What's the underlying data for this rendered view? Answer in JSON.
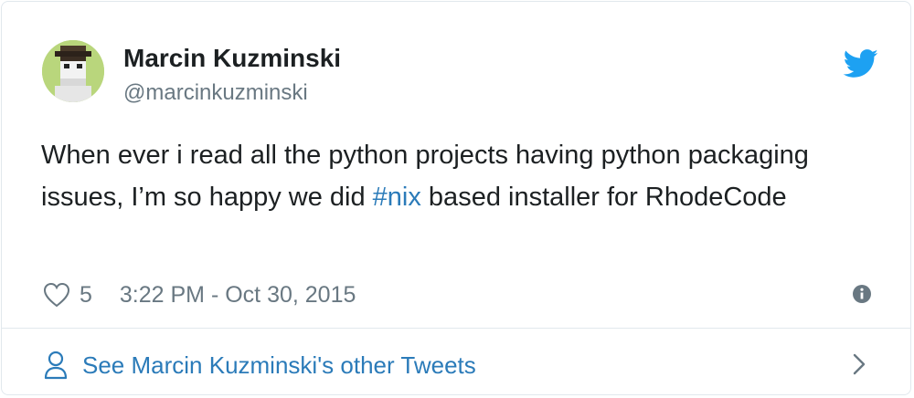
{
  "author": {
    "name": "Marcin Kuzminski",
    "handle": "@marcinkuzminski",
    "avatar_icon": "pixel-avatar-icon"
  },
  "tweet": {
    "text_part1": "When ever i read all the python projects having python packaging issues, I’m so happy we did ",
    "hashtag": "#nix",
    "text_part2": " based installer for RhodeCode"
  },
  "meta": {
    "likes": "5",
    "timestamp": "3:22 PM - Oct 30, 2015"
  },
  "footer": {
    "link_label": "See Marcin Kuzminski's other Tweets"
  },
  "icons": {
    "brand": "twitter-bird-icon",
    "like": "heart-icon",
    "info": "info-icon",
    "person": "person-icon",
    "chevron": "chevron-right-icon"
  },
  "colors": {
    "brand": "#1da1f2",
    "link": "#2b7bb9",
    "text": "#1c2022",
    "muted": "#697882",
    "border": "#e1e8ed"
  }
}
